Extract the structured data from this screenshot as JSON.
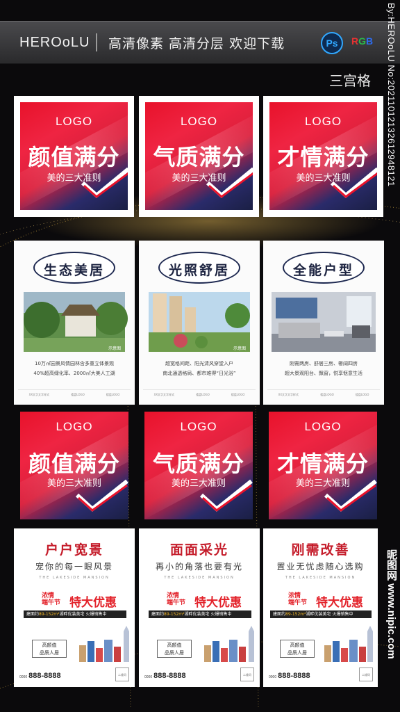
{
  "header": {
    "brand": "HEROoLU",
    "slogan": "高清像素  高清分层  欢迎下载",
    "ps_icon": "Ps",
    "rgb_letters": [
      "R",
      "G",
      "B"
    ],
    "subtitle": "三宫格"
  },
  "side_text": "By:HEROoLU No:20211012132612948121",
  "watermark": "昵图网 www.nipic.com",
  "colors": {
    "accent_red": "#e8122b",
    "deep_navy": "#1c2340",
    "promo_red": "#c51d2b",
    "ps_blue": "#31a8ff",
    "rgb": [
      "#e63232",
      "#2ab84a",
      "#2d6cf0"
    ]
  },
  "top_cards": [
    {
      "logo": "LOGO",
      "headline": "颜值满分",
      "tagline": "美的三大准则",
      "icon": "check-icon"
    },
    {
      "logo": "LOGO",
      "headline": "气质满分",
      "tagline": "美的三大准则",
      "icon": "check-icon"
    },
    {
      "logo": "LOGO",
      "headline": "才情满分",
      "tagline": "美的三大准则",
      "icon": "check-icon"
    }
  ],
  "middle_posters": [
    {
      "title": "生态美居",
      "photo_caption": "示意图",
      "lines": [
        "10万㎡园景风情园林含多重立体景观",
        "40%超高绿化率、2000㎡大美人工湖"
      ],
      "footer_logos": [
        "XX文字文字样式",
        "楼盘LOGO",
        "楼盘LOGO"
      ]
    },
    {
      "title": "光照舒居",
      "photo_caption": "示意图",
      "lines": [
        "超宽格间距、阳光清风穿堂入户",
        "南北通透格局、都市难得“日光浴”"
      ],
      "footer_logos": [
        "XX文字文字样式",
        "楼盘LOGO",
        "楼盘LOGO"
      ]
    },
    {
      "title": "全能户型",
      "photo_caption": "",
      "lines": [
        "刚需两房、舒居三房、奢阔四房",
        "超大景观阳台、飘窗，悦享惬意生活"
      ],
      "footer_logos": [
        "XX文字文字样式",
        "楼盘LOGO",
        "楼盘LOGO"
      ]
    }
  ],
  "bottom_cards": [
    {
      "logo": "LOGO",
      "headline": "颜值满分",
      "tagline": "美的三大准则"
    },
    {
      "logo": "LOGO",
      "headline": "气质满分",
      "tagline": "美的三大准则"
    },
    {
      "logo": "LOGO",
      "headline": "才情满分",
      "tagline": "美的三大准则"
    }
  ],
  "promos": [
    {
      "title": "户户宽景",
      "subtitle": "宠你的每一眼风景"
    },
    {
      "title": "面面采光",
      "subtitle": "再小的角落也要有光"
    },
    {
      "title": "刚需改善",
      "subtitle": "置业无忧虑随心选购"
    }
  ],
  "promo_common": {
    "english": "THE LAKESIDE MANSION",
    "deal_small_1": "浓情",
    "deal_small_2": "端午节",
    "deal_big": "特大优惠",
    "bar_prefix": "建面约",
    "bar_area": "89-152m²",
    "bar_suffix": "湖畔优装美宅 火爆销售中",
    "badge_line1": "高颜值",
    "badge_line2": "品质人居",
    "phone_label": "咨询热线",
    "phone": "888-8888",
    "phone_prefix": "0000",
    "qr_label": "二维码"
  }
}
